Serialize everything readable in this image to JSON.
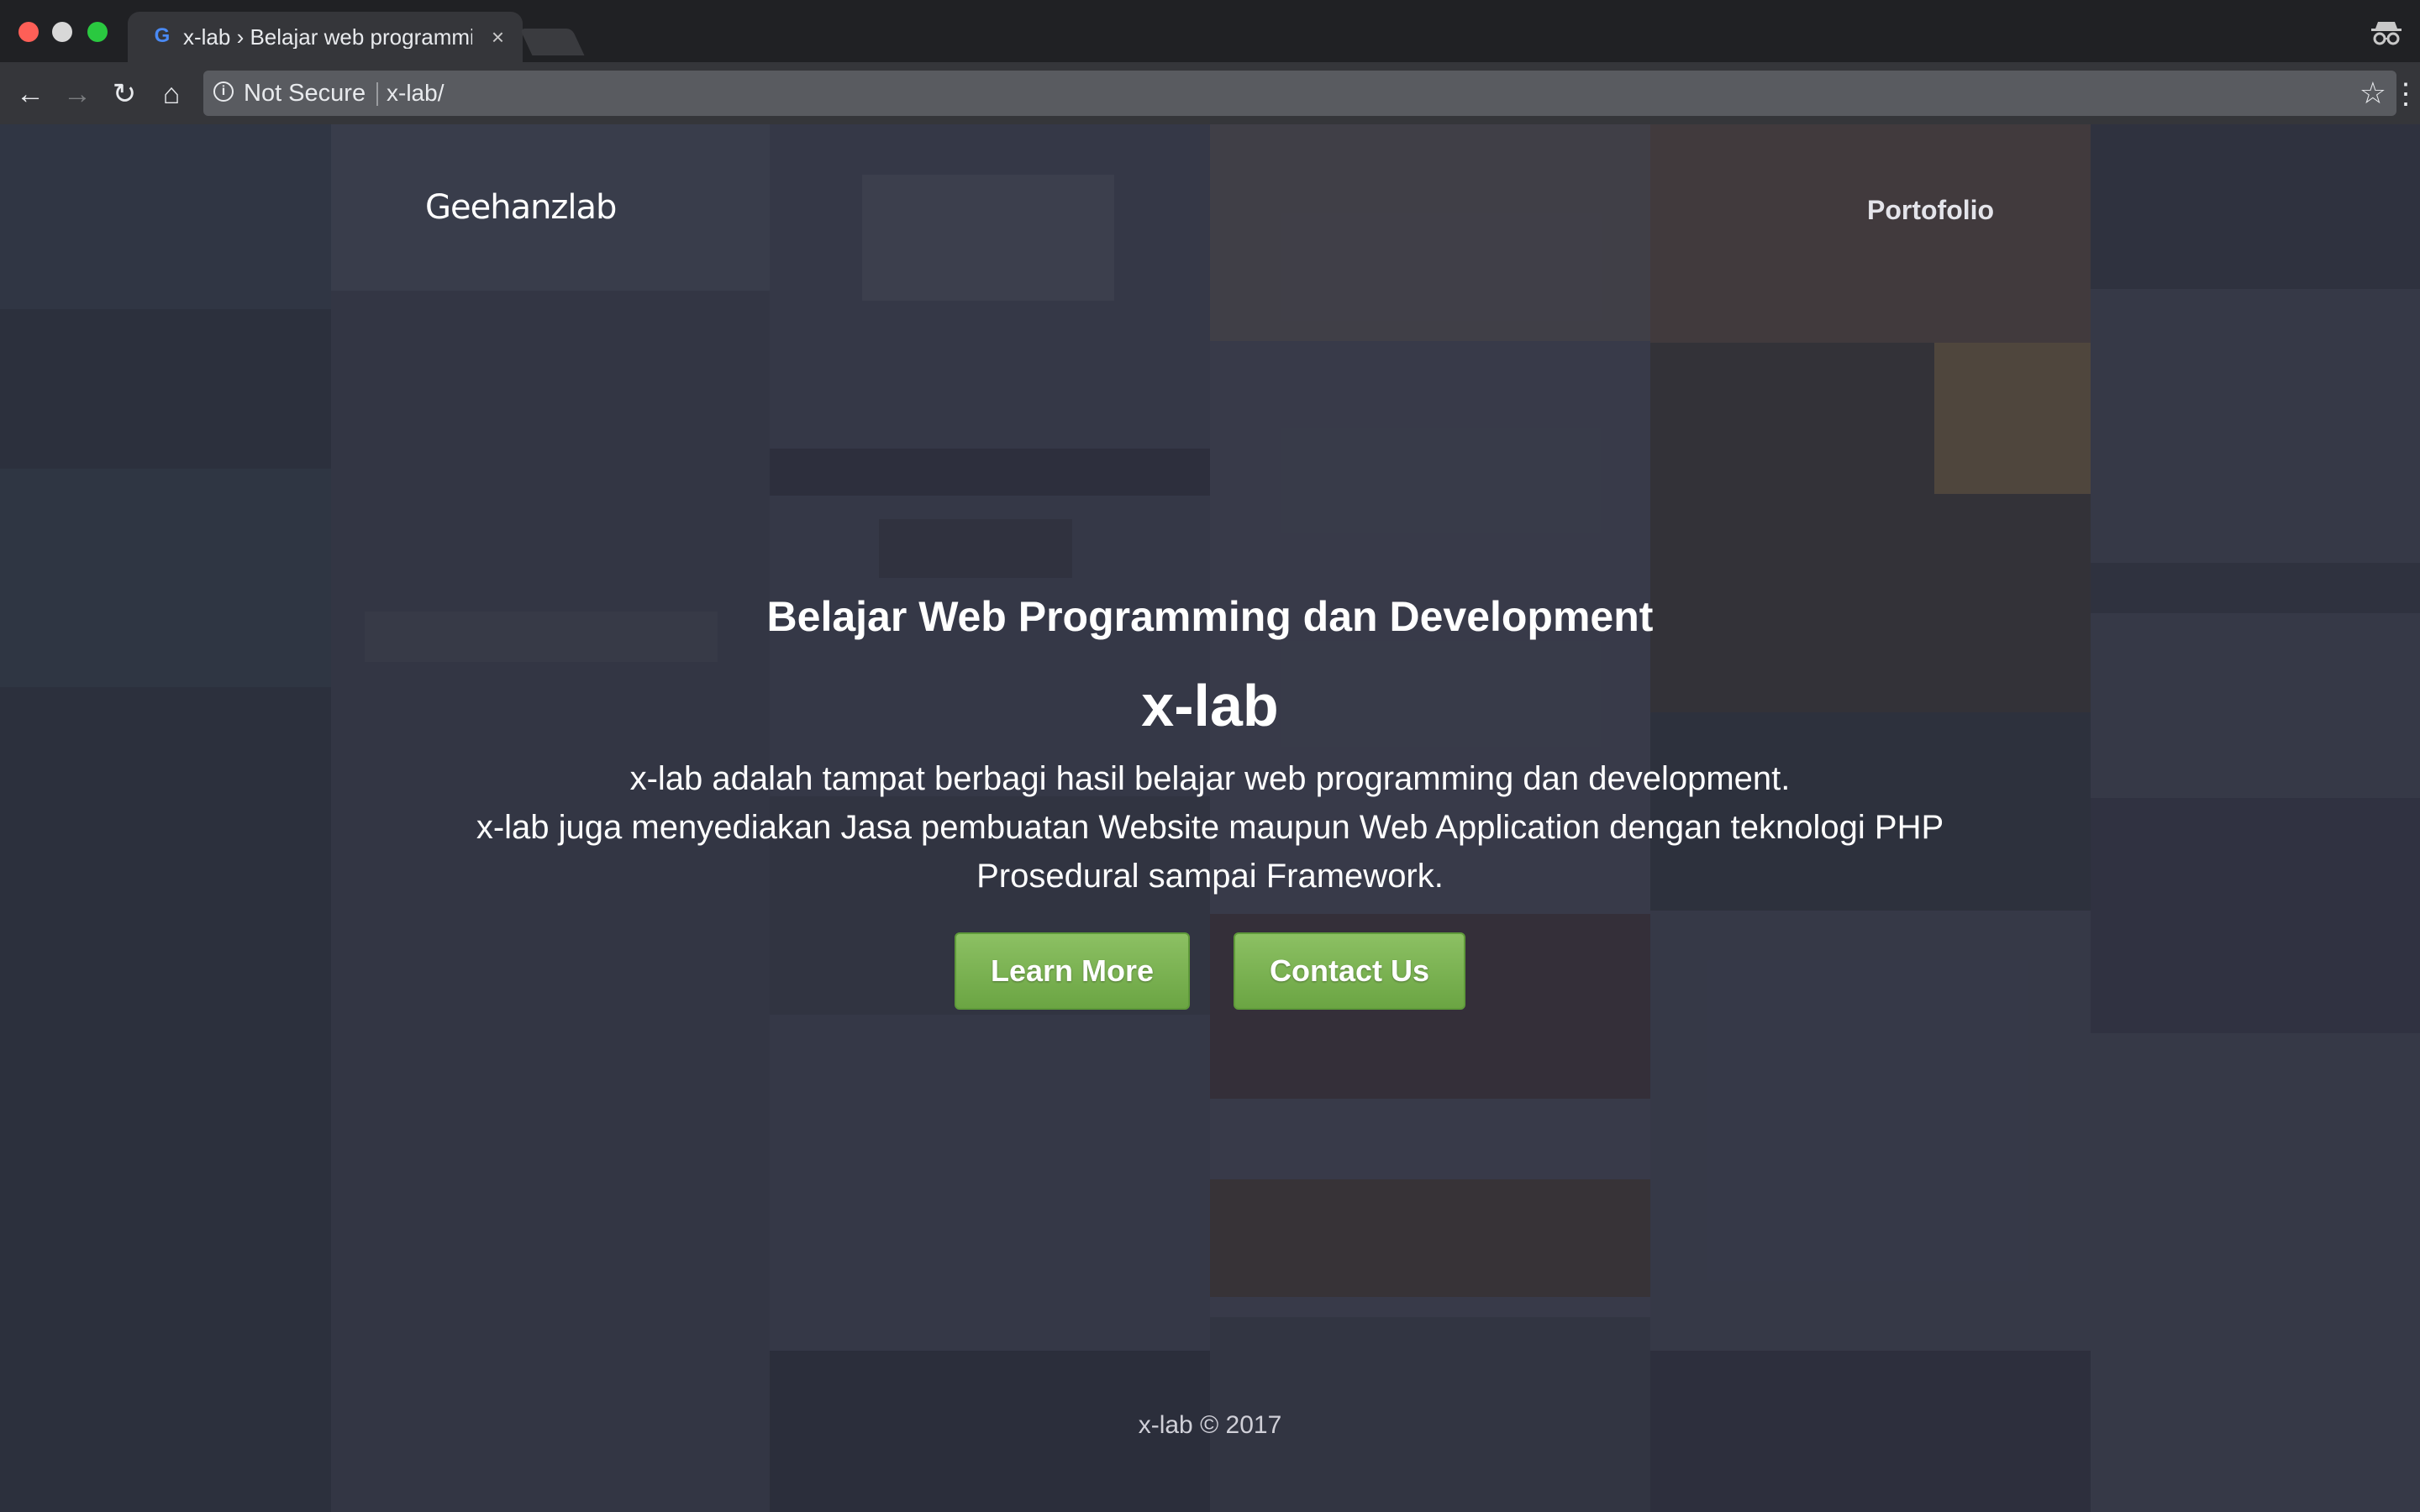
{
  "browser": {
    "tab": {
      "favicon": "G",
      "title": "x-lab › Belajar web programming dan development",
      "close": "×"
    },
    "nav": {
      "back": "←",
      "forward": "→",
      "reload": "↻",
      "home": "⌂"
    },
    "omnibox": {
      "info": "i",
      "security": "Not Secure",
      "url": "x-lab/",
      "bookmark": "☆"
    },
    "menu": "⋮"
  },
  "page": {
    "brand": "Geehanzlab",
    "nav_link": "Portofolio",
    "hero": {
      "subtitle": "Belajar Web Programming dan Development",
      "title": "x-lab",
      "desc_line1": "x-lab adalah tampat berbagi hasil belajar web programming dan development.",
      "desc_line2": "x-lab juga menyediakan Jasa pembuatan Website maupun Web Application dengan teknologi PHP Prosedural sampai Framework."
    },
    "buttons": {
      "learn_more": "Learn More",
      "contact_us": "Contact Us"
    },
    "footer": "x-lab © 2017"
  }
}
